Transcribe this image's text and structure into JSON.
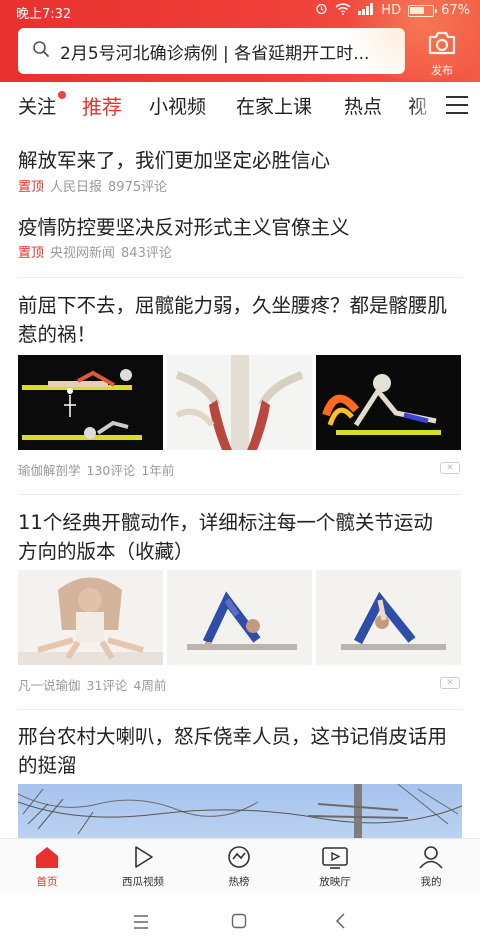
{
  "status_bar": {
    "time": "晚上7:32",
    "network": "HD",
    "battery": "67%"
  },
  "search": {
    "query": "2月5号河北确诊病例 | 各省延期开工时..."
  },
  "publish": {
    "label": "发布"
  },
  "tabs": [
    {
      "label": "关注",
      "has_dot": true
    },
    {
      "label": "推荐",
      "active": true
    },
    {
      "label": "小视频"
    },
    {
      "label": "在家上课"
    },
    {
      "label": "热点"
    },
    {
      "label": "视"
    }
  ],
  "feed": {
    "pinned": [
      {
        "title": "解放军来了，我们更加坚定必胜信心",
        "tag": "置顶",
        "source": "人民日报",
        "comments": "8975评论"
      },
      {
        "title": "疫情防控要坚决反对形式主义官僚主义",
        "tag": "置顶",
        "source": "央视网新闻",
        "comments": "843评论"
      }
    ],
    "articles": [
      {
        "title_line1": "前屈下不去，屈髋能力弱，久坐腰疼？都是髂腰肌",
        "title_line2": "惹的祸！",
        "source": "瑜伽解剖学",
        "comments": "130评论",
        "time": "1年前",
        "dislike": "✕"
      },
      {
        "title_line1": "11个经典开髋动作，详细标注每一个髋关节运动",
        "title_line2": "方向的版本（收藏）",
        "source": "凡一说瑜伽",
        "comments": "31评论",
        "time": "4周前",
        "dislike": "✕"
      },
      {
        "title_line1": "邢台农村大喇叭，怒斥侥幸人员，这书记俏皮话用",
        "title_line2": "的挺溜"
      }
    ]
  },
  "bottom_nav": [
    {
      "label": "首页",
      "icon": "home-icon",
      "active": true
    },
    {
      "label": "西瓜视频",
      "icon": "play-icon"
    },
    {
      "label": "热榜",
      "icon": "trending-icon"
    },
    {
      "label": "放映厅",
      "icon": "tv-icon"
    },
    {
      "label": "我的",
      "icon": "profile-icon"
    }
  ],
  "colors": {
    "brand_red": "#e8312e",
    "meta_gray": "#999999"
  }
}
